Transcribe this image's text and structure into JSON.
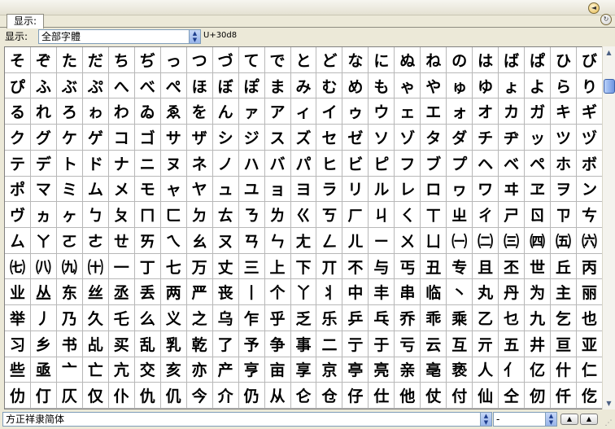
{
  "window": {
    "tab_label": "显示:",
    "menu_icon": "circle-arrow-icon"
  },
  "toolbar": {
    "show_label": "显示:",
    "font_set": "全部字體",
    "code": "U+30d8"
  },
  "bottom": {
    "font_name": "方正祥隶简体",
    "size_value": "-",
    "button_1": "▲",
    "button_2": "▲"
  },
  "glyphs": [
    "そ",
    "ぞ",
    "た",
    "だ",
    "ち",
    "ぢ",
    "っ",
    "つ",
    "づ",
    "て",
    "で",
    "と",
    "ど",
    "な",
    "に",
    "ぬ",
    "ね",
    "の",
    "は",
    "ば",
    "ぱ",
    "ひ",
    "び",
    "ぴ",
    "ふ",
    "ぶ",
    "ぷ",
    "へ",
    "べ",
    "ぺ",
    "ほ",
    "ぼ",
    "ぽ",
    "ま",
    "み",
    "む",
    "め",
    "も",
    "ゃ",
    "や",
    "ゅ",
    "ゆ",
    "ょ",
    "よ",
    "ら",
    "り",
    "る",
    "れ",
    "ろ",
    "ゎ",
    "わ",
    "ゐ",
    "ゑ",
    "を",
    "ん",
    "ァ",
    "ア",
    "ィ",
    "イ",
    "ゥ",
    "ウ",
    "ェ",
    "エ",
    "ォ",
    "オ",
    "カ",
    "ガ",
    "キ",
    "ギ",
    "ク",
    "グ",
    "ケ",
    "ゲ",
    "コ",
    "ゴ",
    "サ",
    "ザ",
    "シ",
    "ジ",
    "ス",
    "ズ",
    "セ",
    "ゼ",
    "ソ",
    "ゾ",
    "タ",
    "ダ",
    "チ",
    "ヂ",
    "ッ",
    "ツ",
    "ヅ",
    "テ",
    "デ",
    "ト",
    "ド",
    "ナ",
    "ニ",
    "ヌ",
    "ネ",
    "ノ",
    "ハ",
    "バ",
    "パ",
    "ヒ",
    "ビ",
    "ピ",
    "フ",
    "ブ",
    "プ",
    "ヘ",
    "ベ",
    "ペ",
    "ホ",
    "ボ",
    "ポ",
    "マ",
    "ミ",
    "ム",
    "メ",
    "モ",
    "ャ",
    "ヤ",
    "ュ",
    "ユ",
    "ョ",
    "ヨ",
    "ラ",
    "リ",
    "ル",
    "レ",
    "ロ",
    "ヮ",
    "ワ",
    "ヰ",
    "ヱ",
    "ヲ",
    "ン",
    "ヴ",
    "ヵ",
    "ヶ",
    "ㄅ",
    "ㄆ",
    "ㄇ",
    "ㄈ",
    "ㄉ",
    "ㄊ",
    "ㄋ",
    "ㄌ",
    "ㄍ",
    "ㄎ",
    "ㄏ",
    "ㄐ",
    "ㄑ",
    "ㄒ",
    "ㄓ",
    "ㄔ",
    "ㄕ",
    "ㄖ",
    "ㄗ",
    "ㄘ",
    "ㄙ",
    "ㄚ",
    "ㄛ",
    "ㄜ",
    "ㄝ",
    "ㄞ",
    "ㄟ",
    "ㄠ",
    "ㄡ",
    "ㄢ",
    "ㄣ",
    "ㄤ",
    "ㄥ",
    "ㄦ",
    "ㄧ",
    "ㄨ",
    "ㄩ",
    "㈠",
    "㈡",
    "㈢",
    "㈣",
    "㈤",
    "㈥",
    "㈦",
    "㈧",
    "㈨",
    "㈩",
    "一",
    "丁",
    "七",
    "万",
    "丈",
    "三",
    "上",
    "下",
    "丌",
    "不",
    "与",
    "丐",
    "丑",
    "专",
    "且",
    "丕",
    "世",
    "丘",
    "丙",
    "业",
    "丛",
    "东",
    "丝",
    "丞",
    "丢",
    "两",
    "严",
    "丧",
    "丨",
    "个",
    "丫",
    "丬",
    "中",
    "丰",
    "串",
    "临",
    "丶",
    "丸",
    "丹",
    "为",
    "主",
    "丽",
    "举",
    "丿",
    "乃",
    "久",
    "乇",
    "么",
    "义",
    "之",
    "乌",
    "乍",
    "乎",
    "乏",
    "乐",
    "乒",
    "乓",
    "乔",
    "乖",
    "乘",
    "乙",
    "乜",
    "九",
    "乞",
    "也",
    "习",
    "乡",
    "书",
    "乩",
    "买",
    "乱",
    "乳",
    "乾",
    "了",
    "予",
    "争",
    "事",
    "二",
    "亍",
    "于",
    "亏",
    "云",
    "互",
    "亓",
    "五",
    "井",
    "亘",
    "亚",
    "些",
    "亟",
    "亠",
    "亡",
    "亢",
    "交",
    "亥",
    "亦",
    "产",
    "亨",
    "亩",
    "享",
    "京",
    "亭",
    "亮",
    "亲",
    "亳",
    "亵",
    "人",
    "亻",
    "亿",
    "什",
    "仁",
    "仂",
    "仃",
    "仄",
    "仅",
    "仆",
    "仇",
    "仉",
    "今",
    "介",
    "仍",
    "从",
    "仑",
    "仓",
    "仔",
    "仕",
    "他",
    "仗",
    "付",
    "仙",
    "仝",
    "仞",
    "仟",
    "仡"
  ]
}
